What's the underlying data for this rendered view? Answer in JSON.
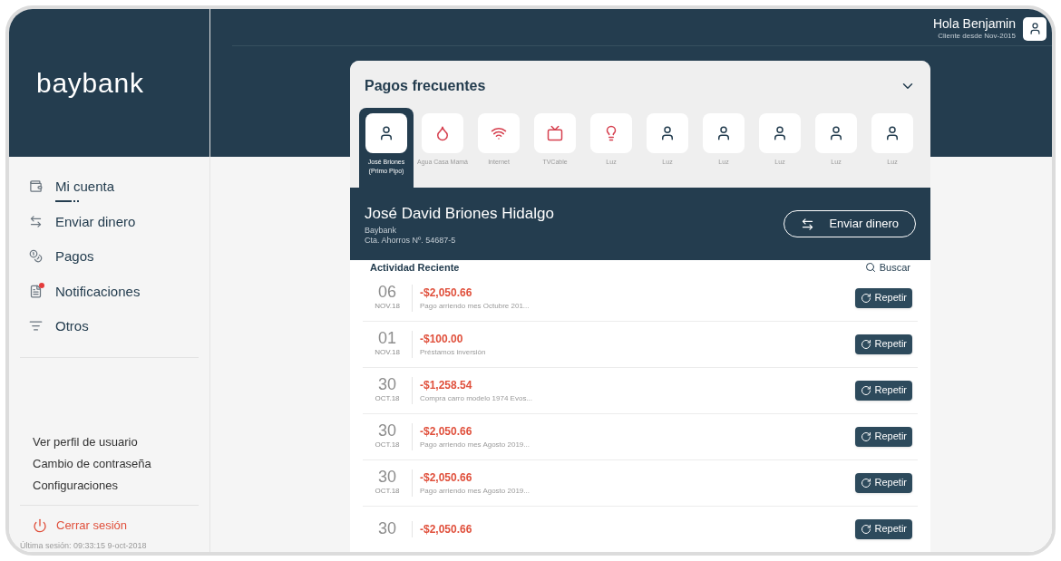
{
  "header": {
    "greeting": "Hola Benjamin",
    "subtitle": "Cliente desde Nov-2015"
  },
  "sidebar": {
    "logo": "baybank",
    "items": [
      {
        "label": "Mi cuenta",
        "kind": "wallet",
        "selected": true,
        "badge": false
      },
      {
        "label": "Enviar dinero",
        "kind": "transfer",
        "selected": false,
        "badge": false
      },
      {
        "label": "Pagos",
        "kind": "coins",
        "selected": false,
        "badge": false
      },
      {
        "label": "Notificaciones",
        "kind": "bell",
        "selected": false,
        "badge": true
      },
      {
        "label": "Otros",
        "kind": "list",
        "selected": false,
        "badge": false
      }
    ],
    "links": [
      "Ver perfil de usuario",
      "Cambio de contraseña",
      "Configuraciones"
    ],
    "logout": "Cerrar sesión",
    "last_session": "Última sesión: 09:33:15 9-oct-2018"
  },
  "frequent": {
    "title": "Pagos frecuentes",
    "expanded": true,
    "items": [
      {
        "label": "José Briones (Primo Pipo)",
        "kind": "person",
        "selected": true
      },
      {
        "label": "Agua Casa Mamá",
        "kind": "water",
        "selected": false
      },
      {
        "label": "Internet",
        "kind": "wifi",
        "selected": false
      },
      {
        "label": "TVCable",
        "kind": "tv",
        "selected": false
      },
      {
        "label": "Luz",
        "kind": "bulb",
        "selected": false
      },
      {
        "label": "Luz",
        "kind": "person",
        "selected": false
      },
      {
        "label": "Luz",
        "kind": "person",
        "selected": false
      },
      {
        "label": "Luz",
        "kind": "person",
        "selected": false
      },
      {
        "label": "Luz",
        "kind": "person",
        "selected": false
      },
      {
        "label": "Luz",
        "kind": "person",
        "selected": false
      }
    ]
  },
  "account": {
    "name": "José David Briones Hidalgo",
    "bank": "Baybank",
    "number": "Cta. Ahorros Nº. 54687-5",
    "send_button": "Enviar dinero"
  },
  "activity": {
    "title": "Actividad Reciente",
    "search": "Buscar",
    "rows": [
      {
        "day": "06",
        "month": "NOV.18",
        "amount": "-$2,050.66",
        "description": "Pago arriendo mes Octubre 201...",
        "button": "Repetir"
      },
      {
        "day": "01",
        "month": "NOV.18",
        "amount": "-$100.00",
        "description": "Préstamos inversión",
        "button": "Repetir"
      },
      {
        "day": "30",
        "month": "OCT.18",
        "amount": "-$1,258.54",
        "description": "Compra carro modelo 1974 Evos...",
        "button": "Repetir"
      },
      {
        "day": "30",
        "month": "OCT.18",
        "amount": "-$2,050.66",
        "description": "Pago arriendo mes Agosto 2019...",
        "button": "Repetir"
      },
      {
        "day": "30",
        "month": "OCT.18",
        "amount": "-$2,050.66",
        "description": "Pago arriendo mes Agosto 2019...",
        "button": "Repetir"
      },
      {
        "day": "30",
        "amount": "-$2,050.66",
        "button": "Repetir"
      }
    ]
  }
}
